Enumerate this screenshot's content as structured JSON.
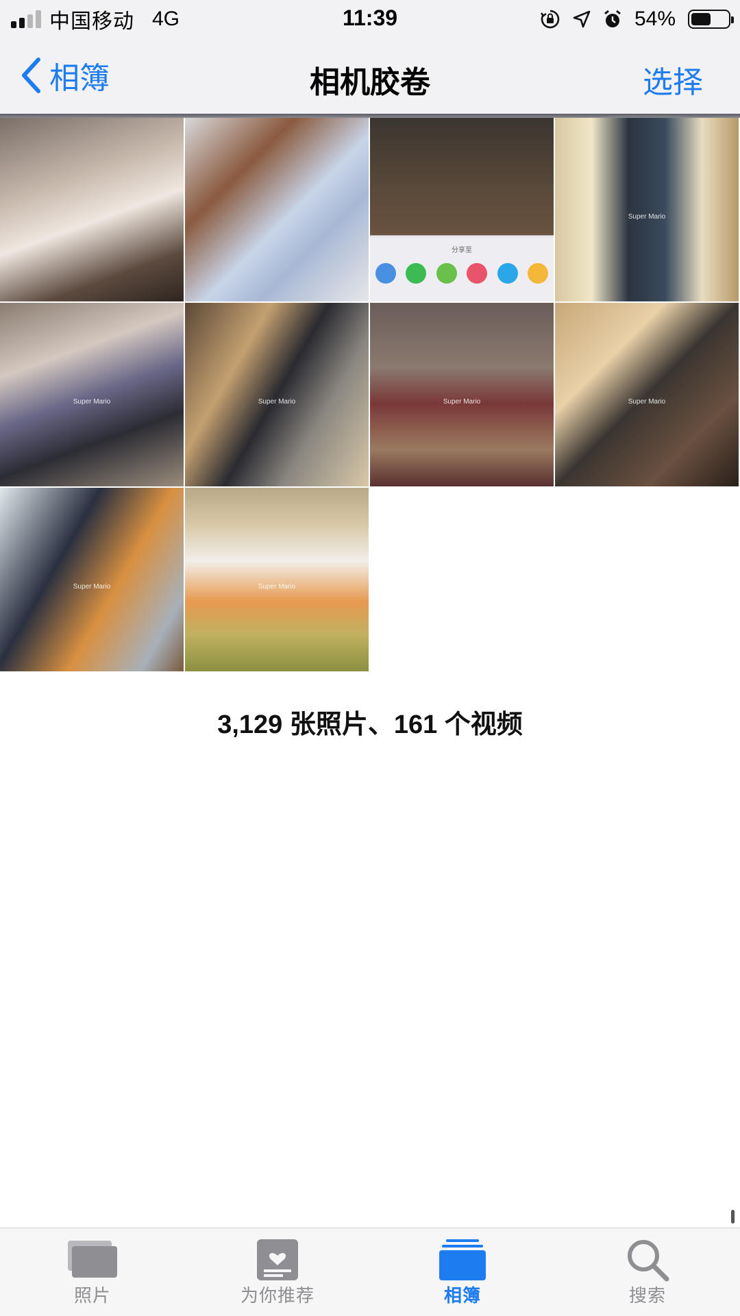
{
  "status_bar": {
    "carrier": "中国移动",
    "network": "4G",
    "time": "11:39",
    "battery_percent_label": "54%",
    "battery_level": 0.54,
    "signal_bars_active": 2,
    "signal_bars_total": 4,
    "icons": [
      "orientation-lock-icon",
      "location-icon",
      "alarm-icon"
    ]
  },
  "nav": {
    "back_label": "相簿",
    "title": "相机胶卷",
    "select_label": "选择"
  },
  "grid": {
    "thumbnails": [
      {
        "id": "1"
      },
      {
        "id": "2"
      },
      {
        "id": "3",
        "share_sheet_title": "分享至"
      },
      {
        "id": "4",
        "watermark": "Super Mario"
      },
      {
        "id": "5",
        "watermark": "Super Mario"
      },
      {
        "id": "6",
        "watermark": "Super Mario"
      },
      {
        "id": "7",
        "watermark": "Super Mario"
      },
      {
        "id": "8",
        "watermark": "Super Mario"
      },
      {
        "id": "9",
        "watermark": "Super Mario"
      },
      {
        "id": "10",
        "watermark": "Super Mario"
      }
    ]
  },
  "summary": "3,129 张照片、161 个视频",
  "tab_bar": {
    "tabs": [
      {
        "label": "照片",
        "icon": "photos-stack-icon",
        "active": false
      },
      {
        "label": "为你推荐",
        "icon": "for-you-icon",
        "active": false
      },
      {
        "label": "相簿",
        "icon": "albums-icon",
        "active": true
      },
      {
        "label": "搜索",
        "icon": "search-icon",
        "active": false
      }
    ]
  },
  "colors": {
    "accent": "#1c7cf0",
    "inactive": "#8e8e93",
    "bar_background": "#f2f2f4"
  }
}
